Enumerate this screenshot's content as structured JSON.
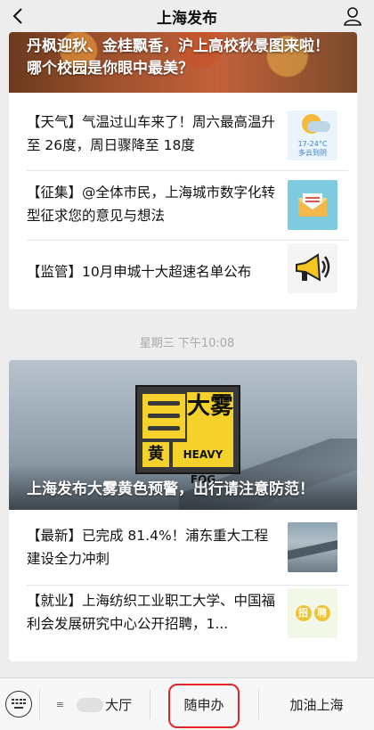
{
  "header": {
    "title": "上海发布"
  },
  "card1": {
    "hero_caption": "丹枫迎秋、金桂飘香，沪上高校秋景图来啦！哪个校园是你眼中最美？",
    "items": [
      {
        "text": "【天气】气温过山车来了！周六最高温升至 26度，周日骤降至 18度",
        "thumb": {
          "line1": "17-24°C",
          "line2": "多云到阴"
        }
      },
      {
        "text": "【征集】@全体市民，上海城市数字化转型征求您的意见与想法"
      },
      {
        "text": "【监管】10月申城十大超速名单公布"
      }
    ]
  },
  "timestamp": "星期三 下午10:08",
  "card2": {
    "sign": {
      "big": "大雾",
      "color": "黄",
      "en": "HEAVY FOG"
    },
    "hero_caption": "上海发布大雾黄色预警，出行请注意防范！",
    "items": [
      {
        "text": "【最新】已完成 81.4%！浦东重大工程建设全力冲刺"
      },
      {
        "text": "【就业】上海纺织工业职工大学、中国福利会发展研究中心公开招聘，1...",
        "thumb": {
          "c1": "招",
          "c2": "聘"
        }
      }
    ]
  },
  "bottom_menu": {
    "item1": "大厅",
    "item2": "随申办",
    "item3": "加油上海"
  }
}
